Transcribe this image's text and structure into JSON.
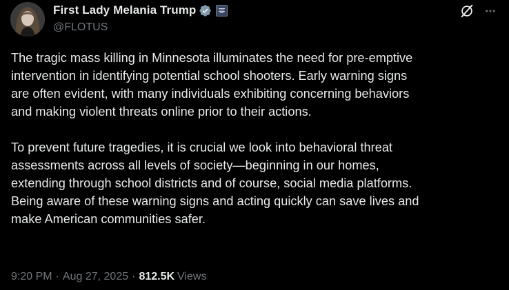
{
  "author": {
    "display_name": "First Lady Melania Trump",
    "handle": "@FLOTUS",
    "verified": true
  },
  "tweet": {
    "paragraph1_lines": [
      "The tragic mass killing in Minnesota illuminates the need for pre-emptive",
      "intervention in identifying potential school shooters. Early warning signs",
      "are often evident, with many individuals exhibiting concerning behaviors",
      "and making violent threats online prior to their actions."
    ],
    "paragraph2_lines": [
      "To prevent future tragedies, it is crucial we look into behavioral threat",
      "assessments across all levels of society—beginning in our homes,",
      "extending through school districts and of course, social media platforms.",
      "Being aware of these warning signs and acting quickly can save lives and",
      "make American communities safer."
    ]
  },
  "meta": {
    "time": "9:20 PM",
    "separator": "·",
    "date": "Aug 27, 2025",
    "views_count": "812.5K",
    "views_label": "Views"
  },
  "icons": {
    "verified": "verified-badge-icon",
    "affiliate": "government-affiliate-badge-icon",
    "grok": "grok-icon",
    "more": "more-options-icon"
  },
  "colors": {
    "background": "#000000",
    "text_primary": "#e7e9ea",
    "text_secondary": "#71767b",
    "verified_badge": "#829aab"
  }
}
